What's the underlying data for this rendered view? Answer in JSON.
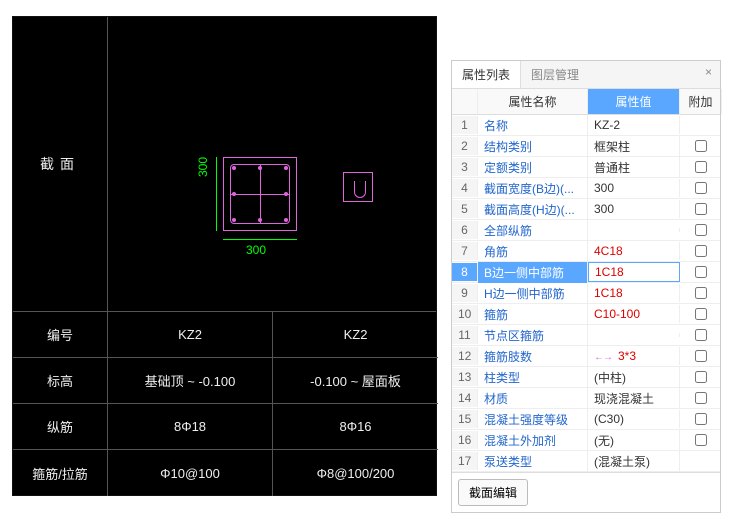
{
  "cad": {
    "section_label": "截面",
    "dim_v": "300",
    "dim_h": "300",
    "rows": [
      {
        "label": "编号",
        "col1": "KZ2",
        "col2": "KZ2"
      },
      {
        "label": "标高",
        "col1": "基础顶 ~ -0.100",
        "col2": "-0.100 ~ 屋面板"
      },
      {
        "label": "纵筋",
        "col1": "8Φ18",
        "col2": "8Φ16"
      },
      {
        "label": "箍筋/拉筋",
        "col1": "Φ10@100",
        "col2": "Φ8@100/200"
      }
    ]
  },
  "tabs": {
    "props": "属性列表",
    "layers": "图层管理"
  },
  "header": {
    "name": "属性名称",
    "value": "属性值",
    "extra": "附加"
  },
  "props": [
    {
      "idx": 1,
      "name": "名称",
      "value": "KZ-2",
      "chk": false,
      "red": false
    },
    {
      "idx": 2,
      "name": "结构类别",
      "value": "框架柱",
      "chk": true,
      "red": false
    },
    {
      "idx": 3,
      "name": "定额类别",
      "value": "普通柱",
      "chk": true,
      "red": false
    },
    {
      "idx": 4,
      "name": "截面宽度(B边)(...",
      "value": "300",
      "chk": true,
      "red": false
    },
    {
      "idx": 5,
      "name": "截面高度(H边)(...",
      "value": "300",
      "chk": true,
      "red": false
    },
    {
      "idx": 6,
      "name": "全部纵筋",
      "value": "",
      "chk": true,
      "red": false
    },
    {
      "idx": 7,
      "name": "角筋",
      "value": "4C18",
      "chk": true,
      "red": true
    },
    {
      "idx": 8,
      "name": "B边一侧中部筋",
      "value": "1C18",
      "chk": true,
      "red": true,
      "selected": true
    },
    {
      "idx": 9,
      "name": "H边一侧中部筋",
      "value": "1C18",
      "chk": true,
      "red": true
    },
    {
      "idx": 10,
      "name": "箍筋",
      "value": "C10-100",
      "chk": true,
      "red": true
    },
    {
      "idx": 11,
      "name": "节点区箍筋",
      "value": "",
      "chk": true,
      "red": false
    },
    {
      "idx": 12,
      "name": "箍筋肢数",
      "value": "3*3",
      "chk": true,
      "red": true,
      "marker": true
    },
    {
      "idx": 13,
      "name": "柱类型",
      "value": "(中柱)",
      "chk": true,
      "red": false
    },
    {
      "idx": 14,
      "name": "材质",
      "value": "现浇混凝土",
      "chk": true,
      "red": false
    },
    {
      "idx": 15,
      "name": "混凝土强度等级",
      "value": "(C30)",
      "chk": true,
      "red": false
    },
    {
      "idx": 16,
      "name": "混凝土外加剂",
      "value": "(无)",
      "chk": true,
      "red": false
    },
    {
      "idx": 17,
      "name": "泵送类型",
      "value": "(混凝土泵)",
      "chk": false,
      "red": false
    }
  ],
  "footer_btn": "截面编辑"
}
